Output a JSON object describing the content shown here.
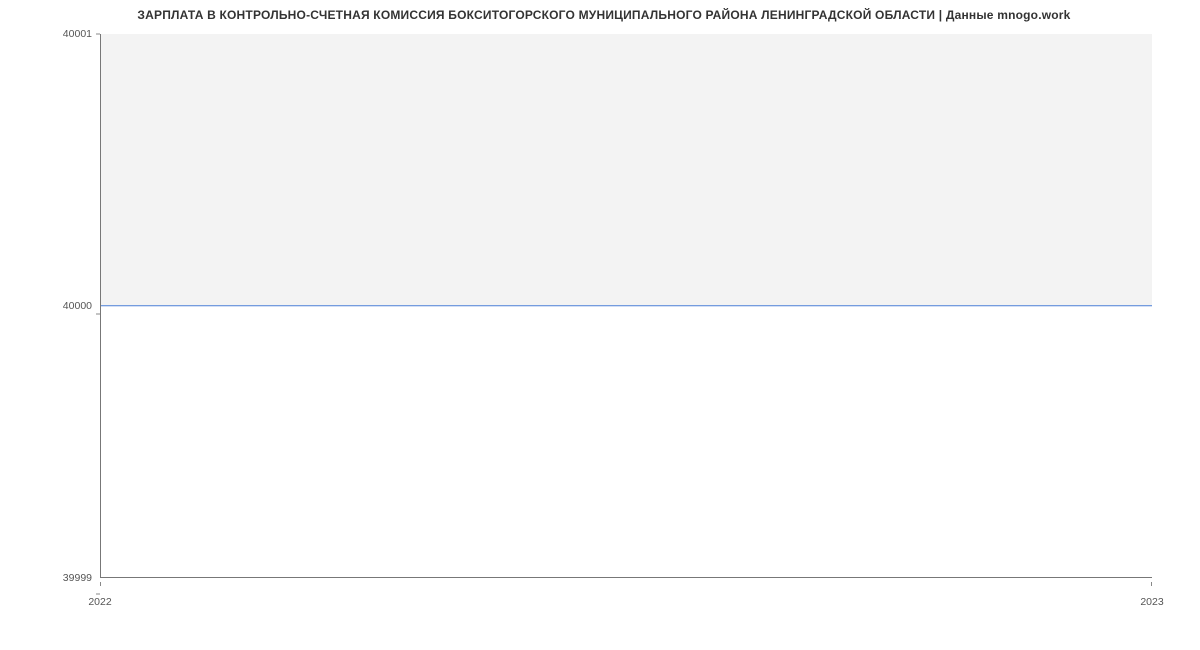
{
  "chart_data": {
    "type": "line",
    "title": "ЗАРПЛАТА В КОНТРОЛЬНО-СЧЕТНАЯ КОМИССИЯ БОКСИТОГОРСКОГО МУНИЦИПАЛЬНОГО РАЙОНА ЛЕНИНГРАДСКОЙ ОБЛАСТИ | Данные mnogo.work",
    "x": [
      "2022",
      "2023"
    ],
    "values": [
      40000,
      40000
    ],
    "xlabel": "",
    "ylabel": "",
    "ylim": [
      39999,
      40001
    ],
    "y_ticks": [
      "39999",
      "40000",
      "40001"
    ],
    "x_ticks": [
      "2022",
      "2023"
    ]
  }
}
